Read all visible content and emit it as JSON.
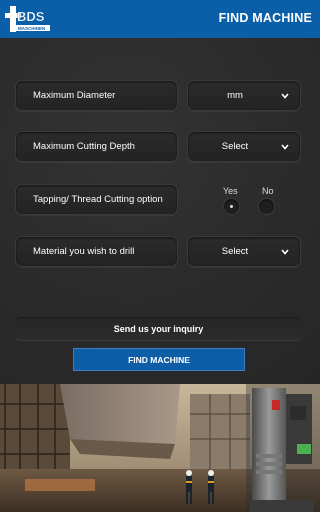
{
  "header": {
    "logo_text": "BDS",
    "logo_subtext": "MASCHINEN",
    "title": "FIND MACHINE"
  },
  "form": {
    "rows": [
      {
        "label": "Maximum Diameter",
        "select_value": "mm"
      },
      {
        "label": "Maximum Cutting Depth",
        "select_value": "Select"
      },
      {
        "label": "Tapping/ Thread Cutting option"
      },
      {
        "label": "Material you wish to drill",
        "select_value": "Select"
      }
    ],
    "tapping_options": [
      {
        "label": "Yes",
        "selected": true
      },
      {
        "label": "No",
        "selected": false
      }
    ]
  },
  "inquiry_text": "Send us your inquiry",
  "button_label": "FIND MACHINE",
  "colors": {
    "header_blue": "#0b5fa8",
    "button_blue": "#0d5ea6",
    "background": "#2a2a2a"
  }
}
